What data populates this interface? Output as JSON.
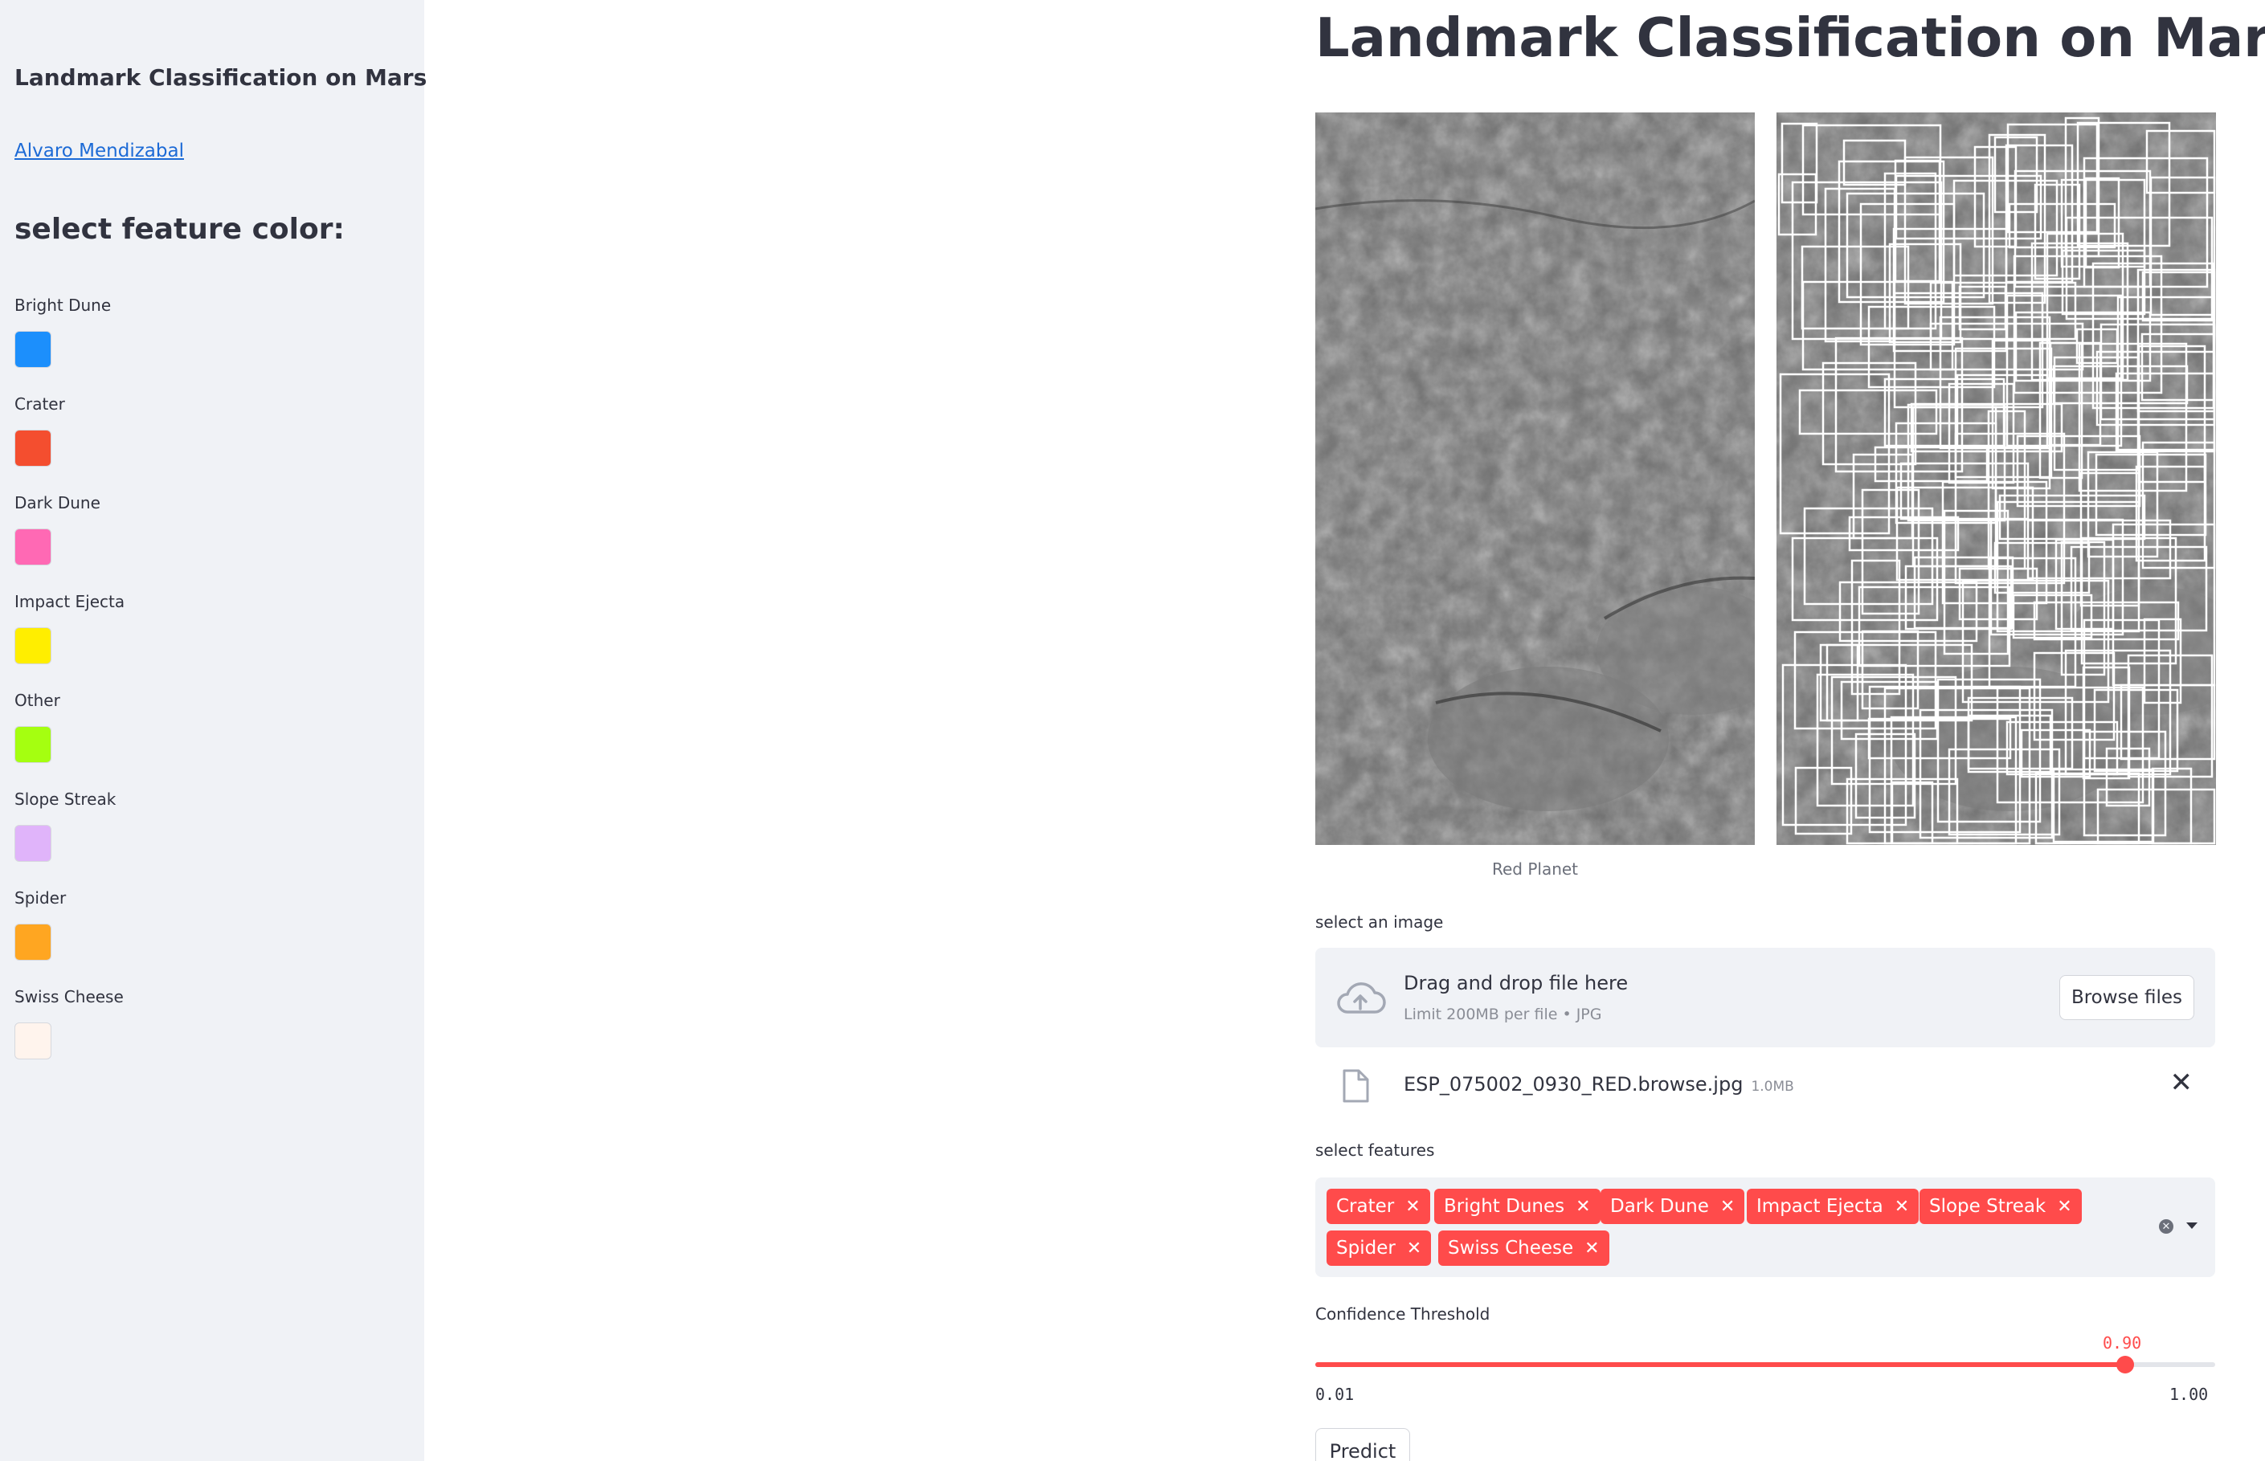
{
  "sidebar": {
    "title": "Landmark Classification on Mars",
    "author_link": "Alvaro Mendizabal",
    "heading": "select feature color:",
    "colors": [
      {
        "label": "Bright Dune",
        "color": "#1c8ffc"
      },
      {
        "label": "Crater",
        "color": "#f44e2f"
      },
      {
        "label": "Dark Dune",
        "color": "#ff69b4"
      },
      {
        "label": "Impact Ejecta",
        "color": "#ffee00"
      },
      {
        "label": "Other",
        "color": "#a5ff10"
      },
      {
        "label": "Slope Streak",
        "color": "#e0b4fa"
      },
      {
        "label": "Spider",
        "color": "#ffa621"
      },
      {
        "label": "Swiss Cheese",
        "color": "#fff4ed"
      }
    ]
  },
  "main": {
    "title": "Landmark Classification on Mars",
    "image_caption": "Red Planet",
    "uploader": {
      "label": "select an image",
      "drop_text": "Drag and drop file here",
      "limit_text": "Limit 200MB per file • JPG",
      "browse_label": "Browse files",
      "file_name": "ESP_075002_0930_RED.browse.jpg",
      "file_size": "1.0MB",
      "icon": "cloud-upload-icon"
    },
    "features": {
      "label": "select features",
      "chips": [
        "Crater",
        "Bright Dunes",
        "Dark Dune",
        "Impact Ejecta",
        "Slope Streak",
        "Spider",
        "Swiss Cheese"
      ],
      "chip_color": "#ff4b4b"
    },
    "slider": {
      "label": "Confidence Threshold",
      "value": "0.90",
      "min": "0.01",
      "max": "1.00",
      "fraction": 0.9
    },
    "predict_label": "Predict"
  }
}
